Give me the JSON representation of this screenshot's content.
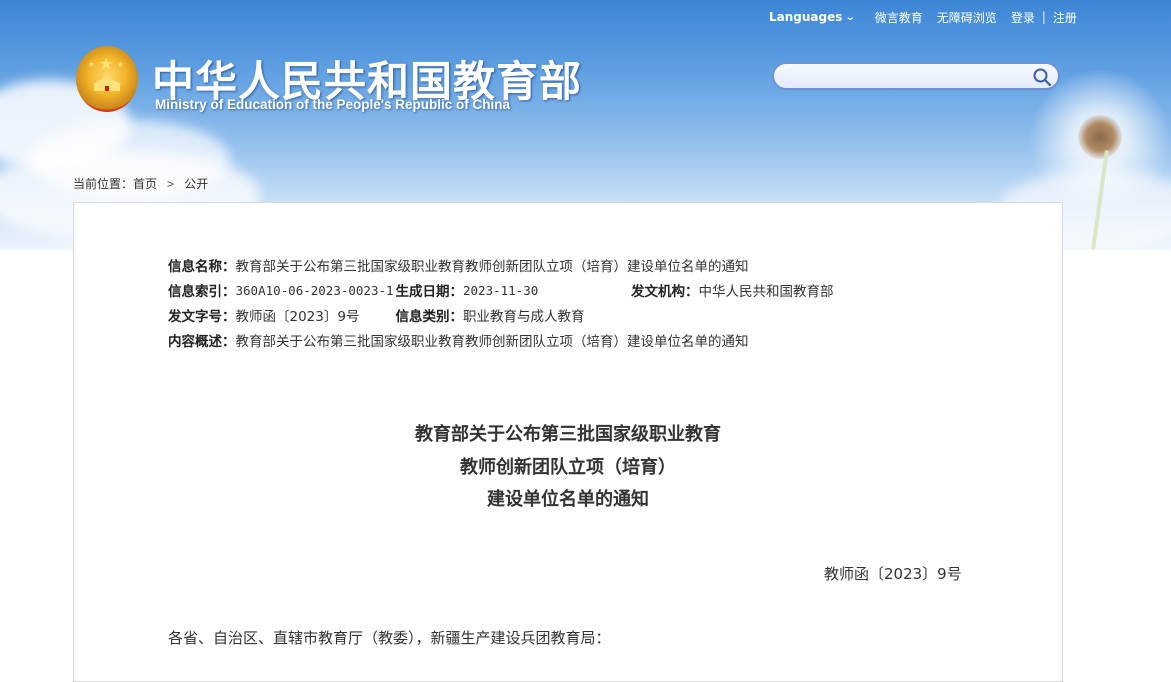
{
  "header": {
    "nav": {
      "languages": "Languages",
      "wechat": "微言教育",
      "accessible": "无障碍浏览",
      "login": "登录",
      "separator": "|",
      "register": "注册"
    },
    "title_cn": "中华人民共和国教育部",
    "title_en": "Ministry of Education of the People's Republic of China",
    "search": {
      "placeholder": "",
      "value": ""
    }
  },
  "breadcrumb": {
    "label": "当前位置：",
    "home": "首页",
    "arrow": ">",
    "current": "公开"
  },
  "meta": {
    "name_key": "信息名称：",
    "name_value": "教育部关于公布第三批国家级职业教育教师创新团队立项（培育）建设单位名单的通知",
    "index_key": "信息索引：",
    "index_value": "360A10-06-2023-0023-1",
    "date_key": "生成日期：",
    "date_value": "2023-11-30",
    "issuer_key": "发文机构：",
    "issuer_value": "中华人民共和国教育部",
    "docno_key": "发文字号：",
    "docno_value": "教师函〔2023〕9号",
    "category_key": "信息类别：",
    "category_value": "职业教育与成人教育",
    "summary_key": "内容概述：",
    "summary_value": "教育部关于公布第三批国家级职业教育教师创新团队立项（培育）建设单位名单的通知"
  },
  "document": {
    "title_lines": [
      "教育部关于公布第三批国家级职业教育",
      "教师创新团队立项（培育）",
      "建设单位名单的通知"
    ],
    "doc_number": "教师函〔2023〕9号",
    "salutation": "各省、自治区、直辖市教育厅（教委），新疆生产建设兵团教育局："
  },
  "colors": {
    "sky_top": "#3d86d6",
    "panel_border": "#d5dbe3",
    "search_border": "#6d90d6",
    "text": "#333333"
  }
}
